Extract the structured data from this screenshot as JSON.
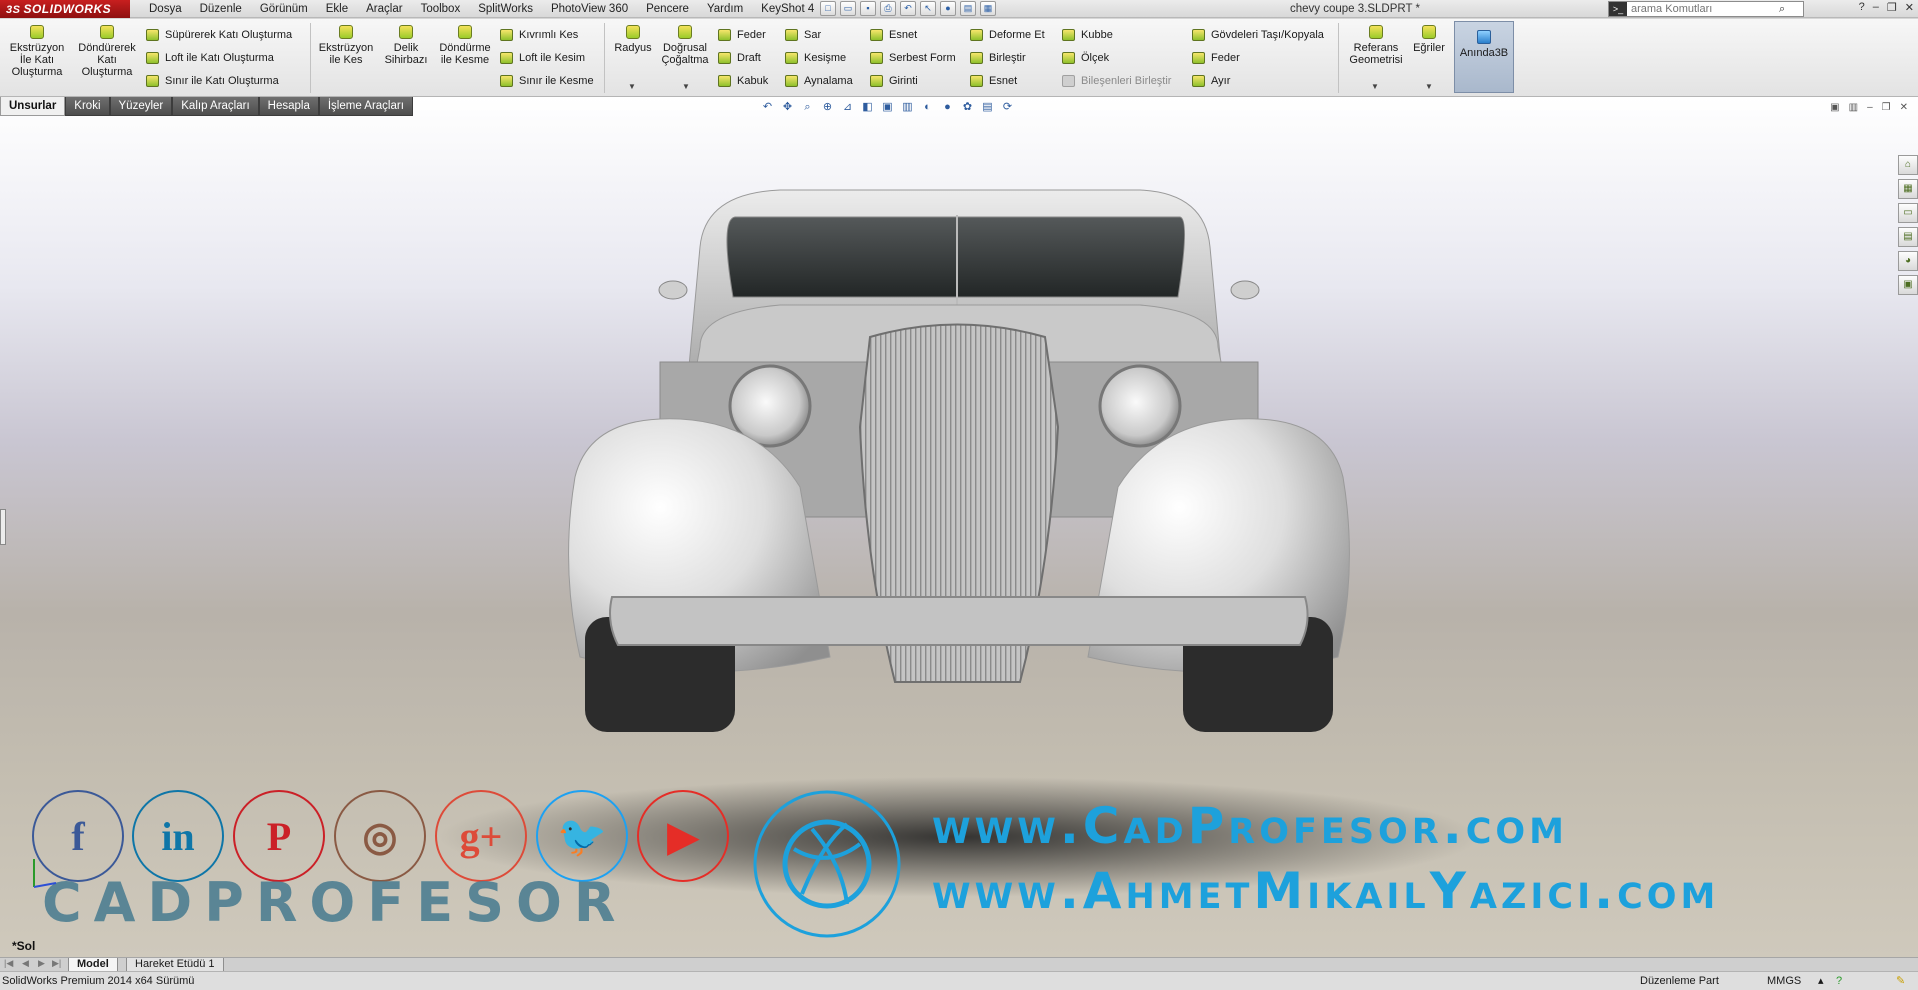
{
  "app": {
    "logo": "SOLIDWORKS",
    "logo_mark": "3S",
    "document_title": "chevy coupe 3.SLDPRT *"
  },
  "menu": [
    "Dosya",
    "Düzenle",
    "Görünüm",
    "Ekle",
    "Araçlar",
    "Toolbox",
    "SplitWorks",
    "PhotoView 360",
    "Pencere",
    "Yardım",
    "KeyShot 4"
  ],
  "search": {
    "placeholder": "arama Komutları"
  },
  "ribbon": {
    "extrude_boss": "Ekstrüzyon İle Katı Oluşturma",
    "revolve_boss": "Döndürerek Katı Oluşturma",
    "sweep_boss": "Süpürerek Katı Oluşturma",
    "loft_boss": "Loft ile Katı Oluşturma",
    "boundary_boss": "Sınır ile Katı Oluşturma",
    "extrude_cut": "Ekstrüzyon ile Kes",
    "hole_wizard": "Delik Sihirbazı",
    "revolve_cut": "Döndürme ile Kesme",
    "swept_cut": "Kıvrımlı Kes",
    "loft_cut": "Loft ile Kesim",
    "boundary_cut": "Sınır ile Kesme",
    "fillet": "Radyus",
    "linear_pattern": "Doğrusal Çoğaltma",
    "rib": "Feder",
    "draft": "Draft",
    "shell": "Kabuk",
    "wrap": "Sar",
    "intersect": "Kesişme",
    "mirror": "Aynalama",
    "flex": "Esnet",
    "freeform": "Serbest Form",
    "indent": "Girinti",
    "deform": "Deforme Et",
    "combine": "Birleştir",
    "flex2": "Esnet",
    "dome": "Kubbe",
    "scale": "Ölçek",
    "join": "Bileşenleri Birleştir",
    "move_copy": "Gövdeleri Taşı/Kopyala",
    "rib2": "Feder",
    "split": "Ayır",
    "ref_geometry": "Referans Geometrisi",
    "curves": "Eğriler",
    "instant3d": "Anında3B"
  },
  "tabs": [
    "Unsurlar",
    "Kroki",
    "Yüzeyler",
    "Kalıp Araçları",
    "Hesapla",
    "İşleme Araçları"
  ],
  "watermark": {
    "site1": "www.CadProfesor.com",
    "site2": "www.AhmetMikailYazici.com",
    "brand": "CADPROFESOR",
    "social": [
      {
        "name": "facebook-icon",
        "glyph": "f",
        "color": "#3b5998"
      },
      {
        "name": "linkedin-icon",
        "glyph": "in",
        "color": "#0e76a8"
      },
      {
        "name": "pinterest-icon",
        "glyph": "P",
        "color": "#cb2027"
      },
      {
        "name": "instagram-icon",
        "glyph": "◎",
        "color": "#8a5a44"
      },
      {
        "name": "googleplus-icon",
        "glyph": "g+",
        "color": "#dd4b39"
      },
      {
        "name": "twitter-icon",
        "glyph": "🐦",
        "color": "#1da1f2"
      },
      {
        "name": "youtube-icon",
        "glyph": "▶",
        "color": "#e52d27"
      }
    ],
    "dribbble_color": "#1da1dc"
  },
  "viewport": {
    "view_label": "*Sol"
  },
  "model_tabs": [
    "Model",
    "Hareket Etüdü 1"
  ],
  "status": {
    "left": "SolidWorks Premium 2014 x64 Sürümü",
    "mode": "Düzenleme Part",
    "units": "MMGS"
  }
}
